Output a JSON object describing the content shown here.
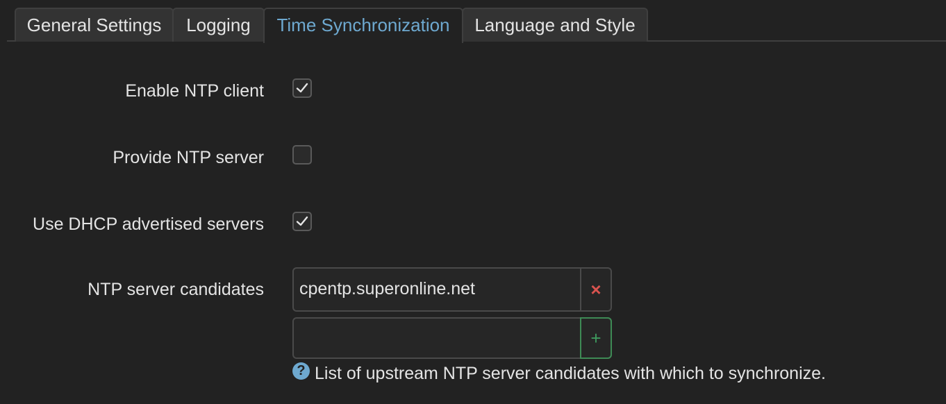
{
  "tabs": [
    {
      "label": "General Settings",
      "active": false
    },
    {
      "label": "Logging",
      "active": false
    },
    {
      "label": "Time Synchronization",
      "active": true
    },
    {
      "label": "Language and Style",
      "active": false
    }
  ],
  "form": {
    "enable_ntp_client": {
      "label": "Enable NTP client",
      "checked": true
    },
    "provide_ntp_server": {
      "label": "Provide NTP server",
      "checked": false
    },
    "use_dhcp_servers": {
      "label": "Use DHCP advertised servers",
      "checked": true
    },
    "ntp_candidates": {
      "label": "NTP server candidates",
      "entries": [
        "cpentp.superonline.net"
      ],
      "new_entry_value": "",
      "remove_symbol": "×",
      "add_symbol": "+",
      "help_icon": "?",
      "help_text": "List of upstream NTP server candidates with which to synchronize."
    }
  },
  "colors": {
    "background": "#222222",
    "active_tab_text": "#6ea9d0",
    "remove": "#d9534f",
    "add": "#3e8a55",
    "help_icon": "#6ea9d0"
  }
}
